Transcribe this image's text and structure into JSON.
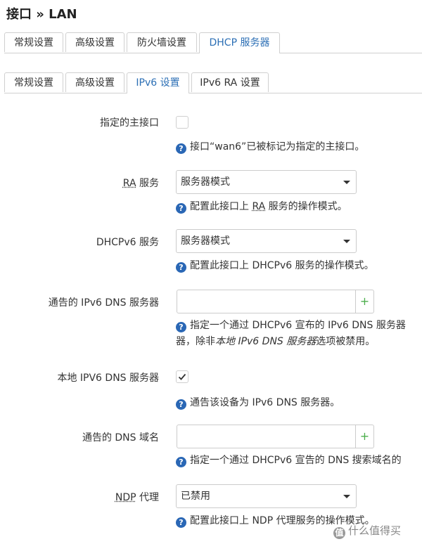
{
  "page_title": "接口 » LAN",
  "main_tabs": [
    {
      "label": "常规设置"
    },
    {
      "label": "高级设置"
    },
    {
      "label": "防火墙设置"
    },
    {
      "label": "DHCP 服务器"
    }
  ],
  "sub_tabs": [
    {
      "label": "常规设置"
    },
    {
      "label": "高级设置"
    },
    {
      "label": "IPv6 设置"
    },
    {
      "label": "IPv6 RA 设置"
    }
  ],
  "fields": {
    "master": {
      "label": "指定的主接口",
      "checked": false,
      "help": "接口“wan6”已被标记为指定的主接口。"
    },
    "ra": {
      "label_abbr": "RA",
      "label_rest": " 服务",
      "value": "服务器模式",
      "help_pre": "配置此接口上 ",
      "help_abbr": "RA",
      "help_post": " 服务的操作模式。"
    },
    "dhcpv6": {
      "label": "DHCPv6 服务",
      "value": "服务器模式",
      "help": "配置此接口上 DHCPv6 服务的操作模式。"
    },
    "dns_servers": {
      "label": "通告的 IPv6 DNS 服务器",
      "value": "",
      "help_line1": "指定一个通过 DHCPv6 宣布的 IPv6 DNS 服务器",
      "help_line2_pre": "器，除非",
      "help_line2_em": "本地 IPv6 DNS 服务器",
      "help_line2_post": "选项被禁用。"
    },
    "local_dns": {
      "label": "本地 IPV6 DNS 服务器",
      "checked": true,
      "help": "通告该设备为 IPv6 DNS 服务器。"
    },
    "dns_domain": {
      "label": "通告的 DNS 域名",
      "value": "",
      "help": "指定一个通过 DHCPv6 宣告的 DNS 搜索域名的"
    },
    "ndp": {
      "label_abbr": "NDP",
      "label_rest": " 代理",
      "value": "已禁用",
      "help": "配置此接口上 NDP 代理服务的操作模式。"
    }
  },
  "plus_glyph": "+",
  "help_glyph": "?",
  "watermark": {
    "icon_glyph": "值",
    "text": "什么值得买"
  },
  "colors": {
    "active_tab": "#2c6fb5",
    "help_icon": "#2a67b5",
    "add_button": "#4cae4c"
  }
}
